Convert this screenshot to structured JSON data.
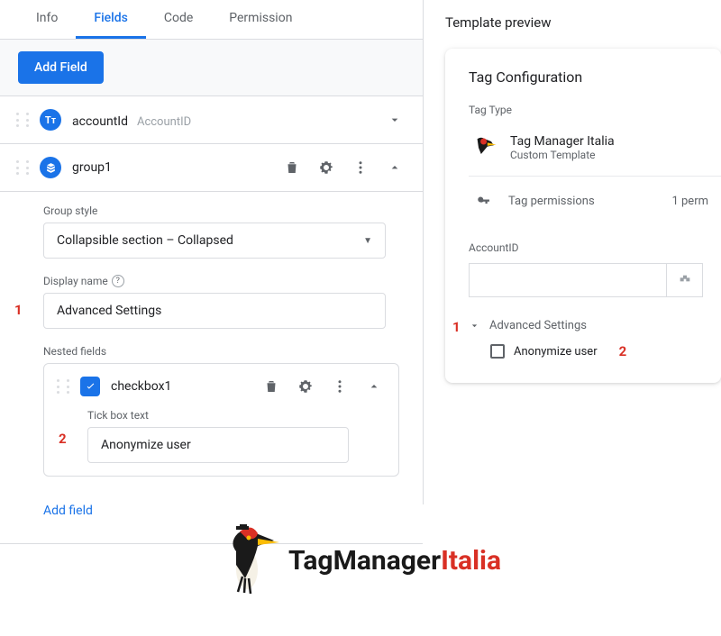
{
  "tabs": {
    "info": "Info",
    "fields": "Fields",
    "code": "Code",
    "permission": "Permission"
  },
  "addFieldBtn": "Add Field",
  "fields": {
    "accountId": {
      "name": "accountId",
      "hint": "AccountID"
    },
    "group1": {
      "name": "group1",
      "groupStyleLabel": "Group style",
      "groupStyleValue": "Collapsible section – Collapsed",
      "displayNameLabel": "Display name",
      "displayNameValue": "Advanced Settings",
      "nestedLabel": "Nested fields",
      "checkbox1": {
        "name": "checkbox1",
        "tickBoxLabel": "Tick box text",
        "tickBoxValue": "Anonymize user"
      },
      "addFieldLink": "Add field"
    }
  },
  "annotations": {
    "one": "1",
    "two": "2",
    "pOne": "1",
    "pTwo": "2"
  },
  "preview": {
    "title": "Template preview",
    "heading": "Tag Configuration",
    "tagTypeLabel": "Tag Type",
    "templateName": "Tag Manager Italia",
    "templateSub": "Custom Template",
    "permissions": "Tag permissions",
    "permissionsCount": "1 perm",
    "accountLabel": "AccountID",
    "advanced": "Advanced Settings",
    "anonymize": "Anonymize user"
  },
  "footer": {
    "brand1": "TagManager",
    "brand2": "Italia"
  }
}
